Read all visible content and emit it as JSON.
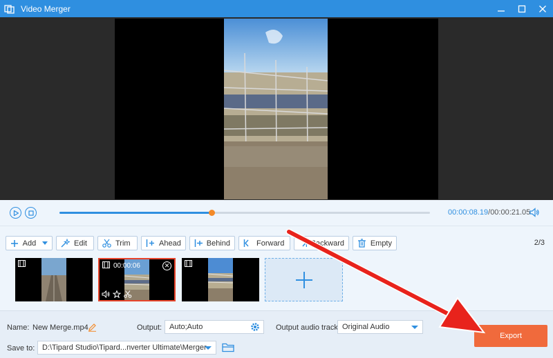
{
  "window": {
    "title": "Video Merger"
  },
  "playback": {
    "current_time": "00:00:08.19",
    "separator": "/",
    "duration": "00:00:21.05",
    "progress": 0.41
  },
  "toolbar": {
    "add_label": "Add",
    "edit_label": "Edit",
    "trim_label": "Trim",
    "ahead_label": "Ahead",
    "behind_label": "Behind",
    "forward_label": "Forward",
    "backward_label": "Backward",
    "empty_label": "Empty",
    "clip_count": "2",
    "clip_count_sep": "/",
    "clip_total": "3"
  },
  "clips": [
    {
      "duration": ""
    },
    {
      "duration": "00:00:06",
      "selected": true
    },
    {
      "duration": ""
    }
  ],
  "bottom": {
    "name_label": "Name:",
    "name_value": "New Merge.mp4",
    "output_label": "Output:",
    "output_value": "Auto;Auto",
    "audio_label": "Output audio track:",
    "audio_value": "Original Audio",
    "save_label": "Save to:",
    "save_value": "D:\\Tipard Studio\\Tipard...nverter Ultimate\\Merger",
    "export_label": "Export"
  },
  "colors": {
    "accent": "#2f8fe0",
    "export": "#f06a3c",
    "selected_border": "#e8442b",
    "arrow": "#e8231c"
  }
}
